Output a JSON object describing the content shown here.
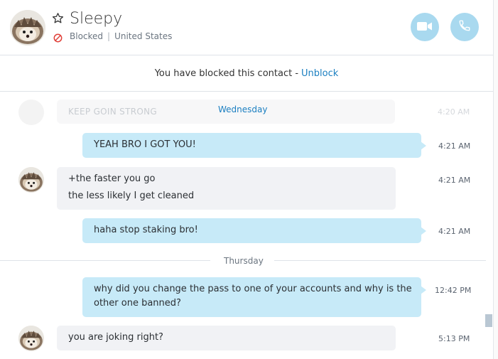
{
  "contact": {
    "name": "Sleepy",
    "status_blocked": "Blocked",
    "location": "United States"
  },
  "banner": {
    "text": "You have blocked this contact -",
    "unblock_label": "Unblock"
  },
  "faded_message": {
    "text": "KEEP GOIN STRONG",
    "time": "4:20 AM"
  },
  "days": {
    "wednesday": "Wednesday",
    "thursday": "Thursday"
  },
  "messages": [
    {
      "direction": "out",
      "lines": [
        "YEAH BRO I GOT YOU!"
      ],
      "time": "4:21 AM"
    },
    {
      "direction": "in",
      "lines": [
        "+the faster you go",
        "the less likely I get cleaned"
      ],
      "time": "4:21 AM"
    },
    {
      "direction": "out",
      "lines": [
        "haha stop staking bro!"
      ],
      "time": "4:21 AM"
    },
    {
      "direction": "out",
      "lines": [
        "why did you change the pass to one of your accounts and why is the",
        "other one banned?"
      ],
      "time": "12:42 PM"
    },
    {
      "direction": "in",
      "lines": [
        "you are joking right?"
      ],
      "time": "5:13 PM"
    }
  ],
  "colors": {
    "accent": "#1b7fc1",
    "outgoing_bubble": "#c7eaf8",
    "incoming_bubble": "#f1f2f5",
    "call_button": "#a9d9ef",
    "blocked_red": "#e0413a"
  },
  "icons": {
    "favorite": "star-icon",
    "blocked": "blocked-icon",
    "video": "video-camera-icon",
    "audio": "phone-icon"
  }
}
